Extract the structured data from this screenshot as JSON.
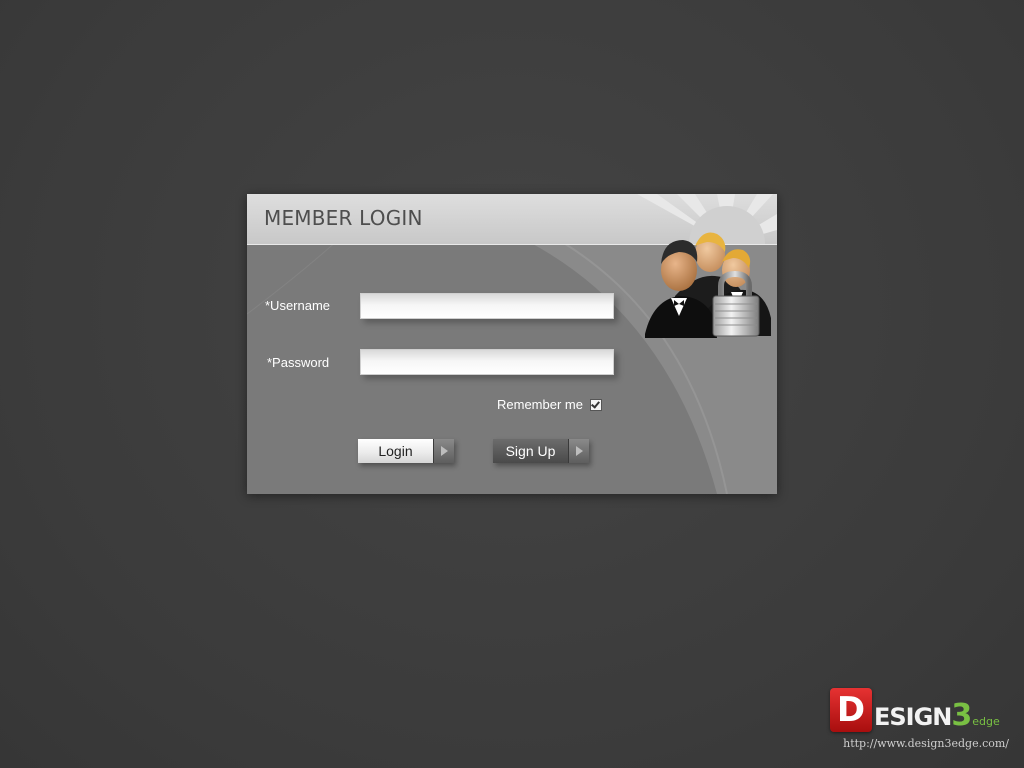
{
  "panel": {
    "title": "MEMBER LOGIN",
    "icon": "users-lock-icon"
  },
  "form": {
    "username_label": "*Username",
    "username_value": "",
    "password_label": "*Password",
    "password_value": "",
    "remember_label": "Remember me",
    "remember_checked": true,
    "login_label": "Login",
    "signup_label": "Sign Up"
  },
  "watermark": {
    "logo_letter": "D",
    "logo_text": "ESIGN",
    "logo_number": "3",
    "logo_suffix": "edge",
    "url": "http://www.design3edge.com/"
  },
  "colors": {
    "background": "#3d3d3d",
    "panel": "#7a7a7a",
    "header": "#d4d4d4",
    "logo_red": "#c81e1e",
    "logo_green": "#79c043"
  }
}
